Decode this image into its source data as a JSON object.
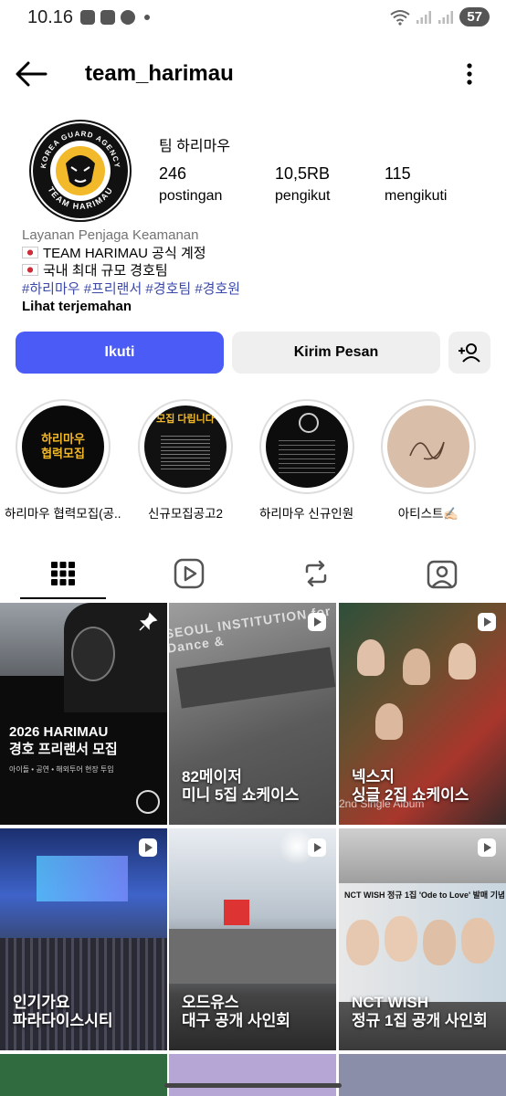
{
  "status_bar": {
    "time": "10.16",
    "battery": "57"
  },
  "header": {
    "username": "team_harimau"
  },
  "profile": {
    "display_name": "팀 하리마우",
    "avatar_text_top": "KOREA GUARD AGENCY",
    "avatar_text_bottom": "TEAM HARIMAU",
    "stats": [
      {
        "value": "246",
        "label": "postingan"
      },
      {
        "value": "10,5RB",
        "label": "pengikut"
      },
      {
        "value": "115",
        "label": "mengikuti"
      }
    ]
  },
  "bio": {
    "category": "Layanan Penjaga Keamanan",
    "line1": "TEAM HARIMAU 공식 계정",
    "line2": "국내 최대 규모 경호팀",
    "hashtags": "#하리마우 #프리랜서 #경호팀 #경호원",
    "see_translation": "Lihat terjemahan"
  },
  "actions": {
    "follow": "Ikuti",
    "message": "Kirim Pesan"
  },
  "highlights": [
    {
      "label": "하리마우 협력모집(공...",
      "img_text": "하리마우 협력모집"
    },
    {
      "label": "신규모집공고2",
      "img_text": "모집 다립니다"
    },
    {
      "label": "하리마우 신규인원모...",
      "img_text": ""
    },
    {
      "label": "아티스트✍🏻",
      "img_text": ""
    }
  ],
  "posts": [
    {
      "line1": "2026 HARIMAU",
      "line2": "경호 프리랜서 모집",
      "sub": "아이돌 • 공연 • 해외투어 현장 투입",
      "pinned": true
    },
    {
      "line1": "82메이저",
      "line2": "미니 5집 쇼케이스",
      "sign": "SEOUL INSTITUTION for Dance &"
    },
    {
      "line1": "넥스지",
      "line2": "싱글 2집 쇼케이스",
      "sign": "2nd Single Album"
    },
    {
      "line1": "인기가요",
      "line2": "파라다이스시티"
    },
    {
      "line1": "오드유스",
      "line2": "대구 공개 사인회"
    },
    {
      "line1": "NCT WISH",
      "line2": "정규 1집 공개 사인회",
      "banner": "NCT WISH 정규 1집 'Ode to Love' 발매 기념"
    }
  ],
  "colors": {
    "follow_button": "#4a5cf5",
    "hashtag": "#3b4aa8",
    "category": "#737373"
  }
}
